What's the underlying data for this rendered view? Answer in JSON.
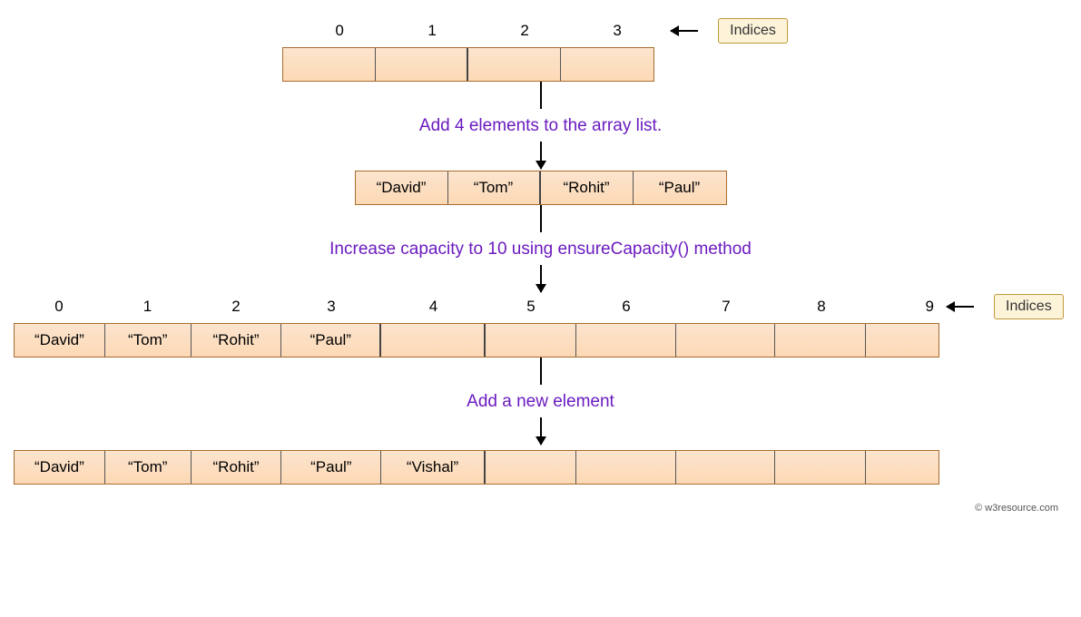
{
  "labels": {
    "indices": "Indices",
    "credit": "© w3resource.com"
  },
  "captions": {
    "c1": "Add 4 elements to the array list.",
    "c2": "Increase capacity to 10 using ensureCapacity() method",
    "c3": "Add a new element"
  },
  "row1": {
    "indices": [
      "0",
      "1",
      "2",
      "3"
    ],
    "cells": [
      "",
      "",
      "",
      ""
    ]
  },
  "row2": {
    "cells": [
      "“David”",
      "“Tom”",
      "“Rohit”",
      "“Paul”"
    ]
  },
  "row3": {
    "indices": [
      "0",
      "1",
      "2",
      "3",
      "4",
      "5",
      "6",
      "7",
      "8",
      "9"
    ],
    "cells": [
      "“David”",
      "“Tom”",
      "“Rohit”",
      "“Paul”",
      "",
      "",
      "",
      "",
      "",
      ""
    ]
  },
  "row4": {
    "cells": [
      "“David”",
      "“Tom”",
      "“Rohit”",
      "“Paul”",
      "“Vishal”",
      "",
      "",
      "",
      "",
      ""
    ]
  }
}
